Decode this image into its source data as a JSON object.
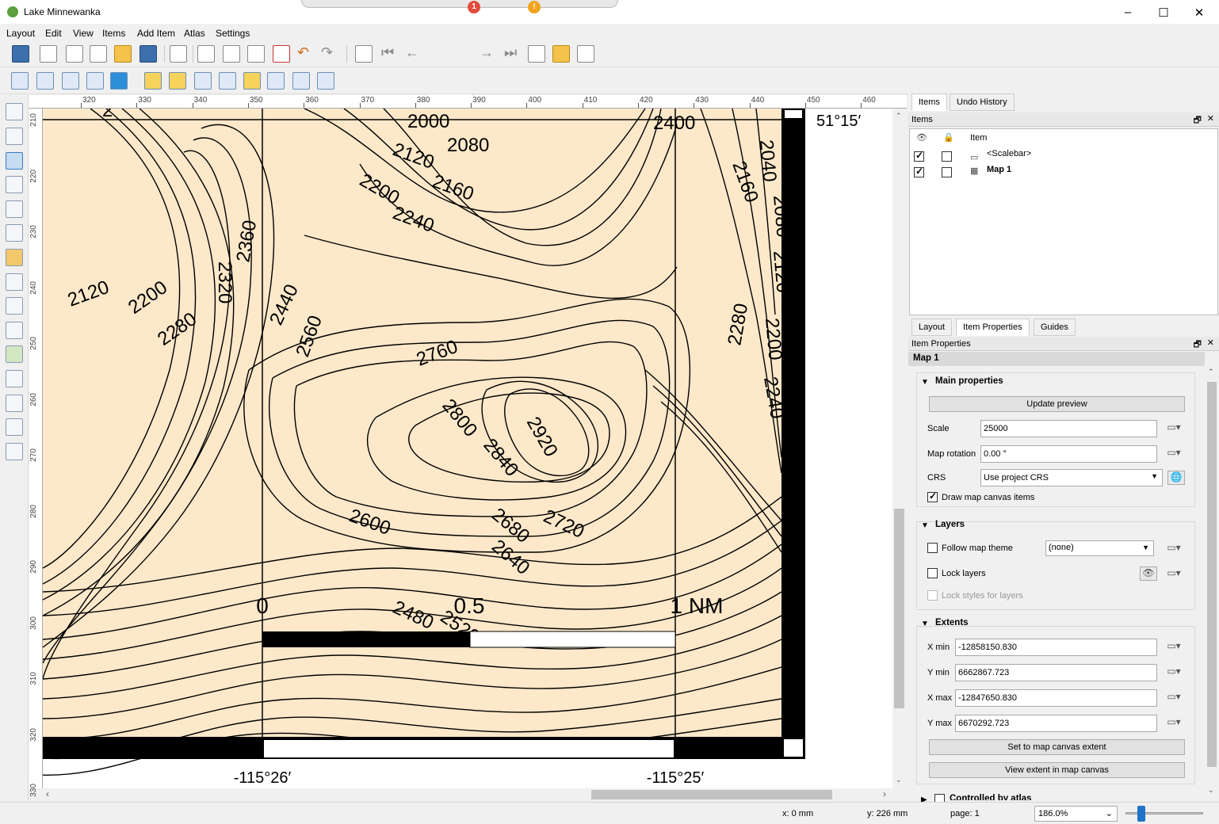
{
  "window": {
    "title": "Lake Minnewanka",
    "notif_badge": "1",
    "warn_badge": "!"
  },
  "menus": [
    "Layout",
    "Edit",
    "View",
    "Items",
    "Add Item",
    "Atlas",
    "Settings"
  ],
  "toolbar": {
    "page_number": "1"
  },
  "ruler": {
    "top_labels": [
      "320",
      "330",
      "340",
      "350",
      "360",
      "370",
      "380",
      "390",
      "400",
      "410",
      "420",
      "430",
      "440",
      "450",
      "460"
    ],
    "left_labels": [
      "210",
      "220",
      "230",
      "240",
      "250",
      "260",
      "270",
      "280",
      "290",
      "300",
      "310",
      "320",
      "330"
    ]
  },
  "map": {
    "frame_color": "#000000",
    "fill_color": "#fde8c9",
    "lat_label": "51°15′",
    "lon_labels": [
      "-115°26′",
      "-115°25′"
    ],
    "contour_labels": [
      "2000",
      "2080",
      "2120",
      "2160",
      "2200",
      "2240",
      "2400",
      "2160",
      "2040",
      "2080",
      "2120",
      "2320",
      "2360",
      "2440",
      "2560",
      "2120",
      "2200",
      "2280",
      "2760",
      "2800",
      "2840",
      "2920",
      "2280",
      "2200",
      "2240",
      "2600",
      "2680",
      "2720",
      "2640",
      "2480",
      "2520",
      "2"
    ],
    "scalebar": {
      "labels": [
        "0",
        "0.5",
        "1 NM"
      ]
    }
  },
  "panels": {
    "top_tabs": [
      "Items",
      "Undo History"
    ],
    "items_title": "Items",
    "items_header": "Item",
    "items": [
      {
        "name": "<Scalebar>",
        "visible": true,
        "locked": false
      },
      {
        "name": "Map 1",
        "visible": true,
        "locked": false
      }
    ],
    "bottom_tabs": [
      "Layout",
      "Item Properties",
      "Guides"
    ],
    "props_title": "Item Properties",
    "item_name": "Map 1",
    "main": {
      "title": "Main properties",
      "update_preview": "Update preview",
      "scale_label": "Scale",
      "scale_value": "25000",
      "rotation_label": "Map rotation",
      "rotation_value": "0.00 °",
      "crs_label": "CRS",
      "crs_value": "Use project CRS",
      "draw_canvas_items": "Draw map canvas items"
    },
    "layers": {
      "title": "Layers",
      "follow_theme": "Follow map theme",
      "theme_value": "(none)",
      "lock_layers": "Lock layers",
      "lock_styles": "Lock styles for layers"
    },
    "extents": {
      "title": "Extents",
      "xmin_label": "X min",
      "xmin_value": "-12858150.830",
      "ymin_label": "Y min",
      "ymin_value": "6662867.723",
      "xmax_label": "X max",
      "xmax_value": "-12847650.830",
      "ymax_label": "Y max",
      "ymax_value": "6670292.723",
      "set_extent": "Set to map canvas extent",
      "view_extent": "View extent in map canvas"
    },
    "atlas": {
      "title": "Controlled by atlas"
    }
  },
  "status": {
    "x": "x: 0 mm",
    "y": "y: 226 mm",
    "page": "page: 1",
    "zoom": "186.0%"
  }
}
